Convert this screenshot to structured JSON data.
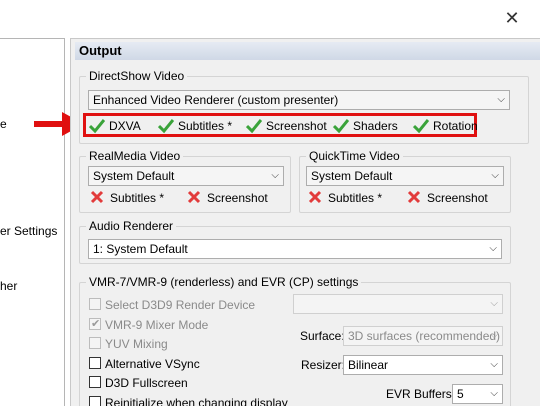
{
  "window": {
    "close_glyph": "✕"
  },
  "sidebar": {
    "items": [
      {
        "label": "e"
      },
      {
        "label": "er Settings"
      },
      {
        "label": "her"
      }
    ]
  },
  "section_title": "Output",
  "directshow": {
    "legend": "DirectShow Video",
    "renderer": "Enhanced Video Renderer (custom presenter)",
    "features": [
      {
        "label": "DXVA",
        "icon": "check-icon"
      },
      {
        "label": "Subtitles *",
        "icon": "check-icon"
      },
      {
        "label": "Screenshot",
        "icon": "check-icon"
      },
      {
        "label": "Shaders",
        "icon": "check-icon"
      },
      {
        "label": "Rotation",
        "icon": "check-icon"
      }
    ]
  },
  "realmedia": {
    "legend": "RealMedia Video",
    "renderer": "System Default",
    "features": [
      {
        "label": "Subtitles *",
        "icon": "cross-icon"
      },
      {
        "label": "Screenshot",
        "icon": "cross-icon"
      }
    ]
  },
  "quicktime": {
    "legend": "QuickTime Video",
    "renderer": "System Default",
    "features": [
      {
        "label": "Subtitles *",
        "icon": "cross-icon"
      },
      {
        "label": "Screenshot",
        "icon": "cross-icon"
      }
    ]
  },
  "audio": {
    "legend": "Audio Renderer",
    "renderer": "1: System Default"
  },
  "vmr": {
    "legend": "VMR-7/VMR-9 (renderless) and EVR (CP) settings",
    "checkboxes": [
      {
        "label": "Select D3D9 Render Device",
        "checked": false,
        "disabled": true
      },
      {
        "label": "VMR-9 Mixer Mode",
        "checked": true,
        "disabled": true
      },
      {
        "label": "YUV Mixing",
        "checked": false,
        "disabled": true
      },
      {
        "label": "Alternative VSync",
        "checked": false,
        "disabled": false
      },
      {
        "label": "D3D Fullscreen",
        "checked": false,
        "disabled": false
      },
      {
        "label": "Reinitialize when changing display",
        "checked": false,
        "disabled": false
      }
    ],
    "device_combo": "",
    "surface_label": "Surface:",
    "surface_value": "3D surfaces (recommended)",
    "resizer_label": "Resizer:",
    "resizer_value": "Bilinear",
    "evr_label": "EVR Buffers:",
    "evr_value": "5"
  },
  "colors": {
    "highlight": "#e01010",
    "check": "#3aa33a",
    "cross": "#e23b3b"
  }
}
